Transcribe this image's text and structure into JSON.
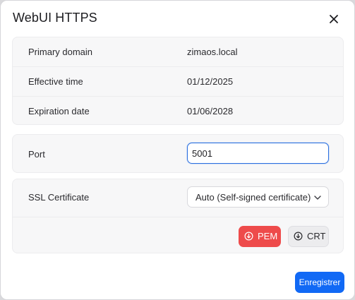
{
  "dialog": {
    "title": "WebUI HTTPS",
    "close_icon": "close-icon"
  },
  "info": {
    "primary_domain": {
      "label": "Primary domain",
      "value": "zimaos.local"
    },
    "effective_time": {
      "label": "Effective time",
      "value": "01/12/2025"
    },
    "expiration_date": {
      "label": "Expiration date",
      "value": "01/06/2028"
    }
  },
  "port": {
    "label": "Port",
    "value": "5001"
  },
  "ssl": {
    "label": "SSL Certificate",
    "selected": "Auto (Self-signed certificate)",
    "pem_label": "PEM",
    "crt_label": "CRT",
    "pem_icon": "download-circle-icon",
    "crt_icon": "download-circle-icon"
  },
  "footer": {
    "save_label": "Enregistrer"
  },
  "colors": {
    "accent": "#1169f5",
    "focus_border": "#2b6fe0",
    "pem": "#ee4b4b"
  }
}
